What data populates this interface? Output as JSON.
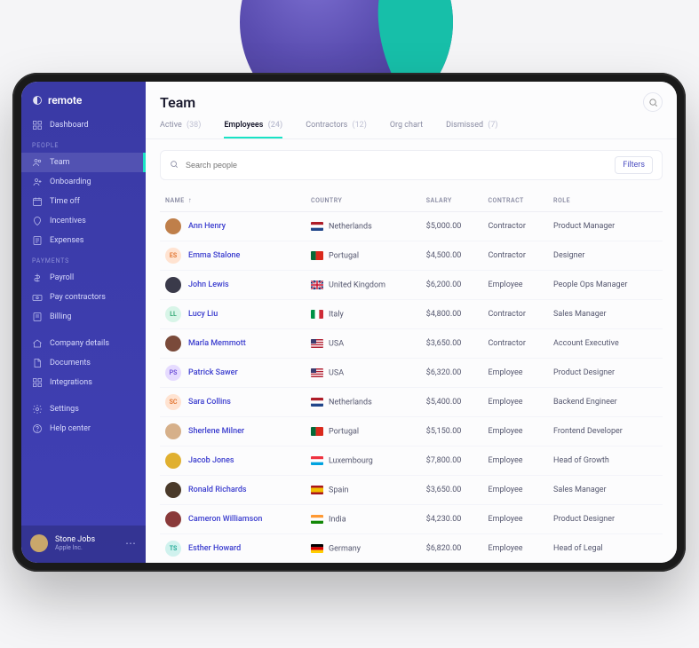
{
  "brand": {
    "name": "remote"
  },
  "sidebar": {
    "top": [
      {
        "icon": "dashboard-icon",
        "label": "Dashboard"
      }
    ],
    "people_label": "PEOPLE",
    "people": [
      {
        "icon": "team-icon",
        "label": "Team",
        "active": true
      },
      {
        "icon": "onboarding-icon",
        "label": "Onboarding"
      },
      {
        "icon": "timeoff-icon",
        "label": "Time off"
      },
      {
        "icon": "incentives-icon",
        "label": "Incentives"
      },
      {
        "icon": "expenses-icon",
        "label": "Expenses"
      }
    ],
    "payments_label": "PAYMENTS",
    "payments": [
      {
        "icon": "payroll-icon",
        "label": "Payroll"
      },
      {
        "icon": "paycontractors-icon",
        "label": "Pay contractors"
      },
      {
        "icon": "billing-icon",
        "label": "Billing"
      }
    ],
    "company": [
      {
        "icon": "companydetails-icon",
        "label": "Company details"
      },
      {
        "icon": "documents-icon",
        "label": "Documents"
      },
      {
        "icon": "integrations-icon",
        "label": "Integrations"
      }
    ],
    "bottom": [
      {
        "icon": "settings-icon",
        "label": "Settings"
      },
      {
        "icon": "help-icon",
        "label": "Help center"
      }
    ],
    "user": {
      "name": "Stone Jobs",
      "sub": "Apple Inc."
    }
  },
  "header": {
    "title": "Team"
  },
  "tabs": [
    {
      "label": "Active",
      "count": "(38)"
    },
    {
      "label": "Employees",
      "count": "(24)",
      "active": true
    },
    {
      "label": "Contractors",
      "count": "(12)"
    },
    {
      "label": "Org chart",
      "count": ""
    },
    {
      "label": "Dismissed",
      "count": "(7)"
    }
  ],
  "toolbar": {
    "search_placeholder": "Search people",
    "filters": "Filters"
  },
  "table": {
    "headers": {
      "name": "NAME",
      "country": "COUNTRY",
      "salary": "SALARY",
      "contract": "CONTRACT",
      "role": "ROLE"
    },
    "rows": [
      {
        "name": "Ann Henry",
        "country": "Netherlands",
        "flag": "nl",
        "salary": "$5,000.00",
        "contract": "Contractor",
        "role": "Product Manager",
        "avatar_bg": "#bf7f4a",
        "initials": ""
      },
      {
        "name": "Emma Stalone",
        "country": "Portugal",
        "flag": "pt",
        "salary": "$4,500.00",
        "contract": "Contractor",
        "role": "Designer",
        "avatar_bg": "#ffe3d1",
        "initials": "ES",
        "initials_color": "#e0702a"
      },
      {
        "name": "John Lewis",
        "country": "United Kingdom",
        "flag": "gb",
        "salary": "$6,200.00",
        "contract": "Employee",
        "role": "People Ops Manager",
        "avatar_bg": "#3a3a4a",
        "initials": ""
      },
      {
        "name": "Lucy Liu",
        "country": "Italy",
        "flag": "it",
        "salary": "$4,800.00",
        "contract": "Contractor",
        "role": "Sales Manager",
        "avatar_bg": "#d8f5e8",
        "initials": "LL",
        "initials_color": "#2aa36f"
      },
      {
        "name": "Marla Memmott",
        "country": "USA",
        "flag": "us",
        "salary": "$3,650.00",
        "contract": "Contractor",
        "role": "Account Executive",
        "avatar_bg": "#7a4a3a",
        "initials": ""
      },
      {
        "name": "Patrick Sawer",
        "country": "USA",
        "flag": "us",
        "salary": "$6,320.00",
        "contract": "Employee",
        "role": "Product Designer",
        "avatar_bg": "#e6dbff",
        "initials": "PS",
        "initials_color": "#6a4cd6"
      },
      {
        "name": "Sara Collins",
        "country": "Netherlands",
        "flag": "nl",
        "salary": "$5,400.00",
        "contract": "Employee",
        "role": "Backend Engineer",
        "avatar_bg": "#ffe3d1",
        "initials": "SC",
        "initials_color": "#e0702a"
      },
      {
        "name": "Sherlene Milner",
        "country": "Portugal",
        "flag": "pt",
        "salary": "$5,150.00",
        "contract": "Employee",
        "role": "Frontend Developer",
        "avatar_bg": "#d6b08a",
        "initials": ""
      },
      {
        "name": "Jacob Jones",
        "country": "Luxembourg",
        "flag": "lu",
        "salary": "$7,800.00",
        "contract": "Employee",
        "role": "Head of Growth",
        "avatar_bg": "#e0b030",
        "initials": ""
      },
      {
        "name": "Ronald Richards",
        "country": "Spain",
        "flag": "es",
        "salary": "$3,650.00",
        "contract": "Employee",
        "role": "Sales Manager",
        "avatar_bg": "#4a3a2a",
        "initials": ""
      },
      {
        "name": "Cameron Williamson",
        "country": "India",
        "flag": "in",
        "salary": "$4,230.00",
        "contract": "Employee",
        "role": "Product Designer",
        "avatar_bg": "#8a3a3a",
        "initials": ""
      },
      {
        "name": "Esther Howard",
        "country": "Germany",
        "flag": "de",
        "salary": "$6,820.00",
        "contract": "Employee",
        "role": "Head of Legal",
        "avatar_bg": "#d0f2ee",
        "initials": "TS",
        "initials_color": "#1aa793"
      }
    ]
  }
}
